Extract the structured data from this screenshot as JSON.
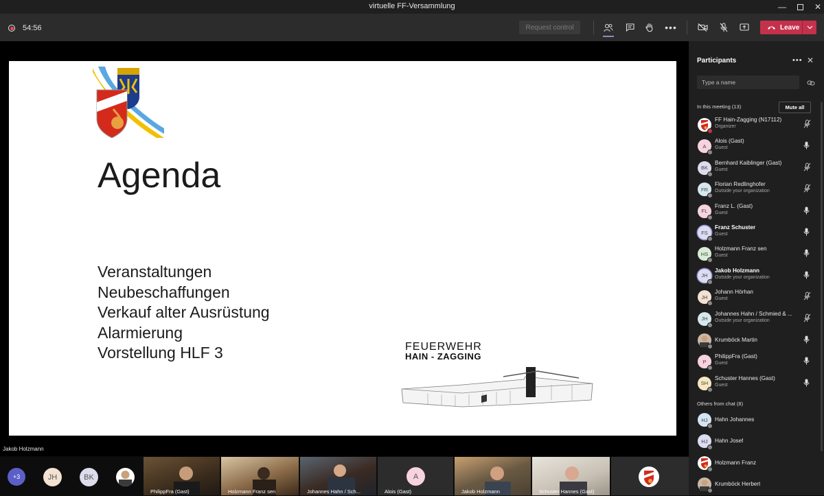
{
  "window": {
    "title": "virtuelle FF-Versammlung"
  },
  "toolbar": {
    "timer": "54:56",
    "request_control_label": "Request control",
    "leave_label": "Leave",
    "colors": {
      "leave": "#c4314b",
      "accent": "#8b8cc7"
    }
  },
  "slide": {
    "heading": "Agenda",
    "items": [
      "Veranstaltungen",
      "Neubeschaffungen",
      "Verkauf alter Ausrüstung",
      "Alarmierung",
      "Vorstellung HLF 3"
    ],
    "logo_line1": "FEUERWEHR",
    "logo_line2": "HAIN - ZAGGING"
  },
  "stage": {
    "speaker_name": "Jakob Holzmann"
  },
  "strip": {
    "overflow_count": "+3",
    "avatars": [
      "JH",
      "BK"
    ],
    "tiles": [
      {
        "name": "PhilippFra (Gast)"
      },
      {
        "name": "Holzmann Franz sen"
      },
      {
        "name": "Johannes Hahn / Sch..."
      },
      {
        "name": "Alois (Gast)",
        "initial": "A"
      },
      {
        "name": "Jakob Holzmann"
      },
      {
        "name": "Schuster Hannes (Gast)"
      }
    ]
  },
  "participants": {
    "title": "Participants",
    "search_placeholder": "Type a name",
    "in_meeting_label": "In this meeting (13)",
    "mute_all_label": "Mute all",
    "others_label": "Others from chat (8)",
    "in_meeting": [
      {
        "initials": "",
        "name": "FF Hain-Zagging (N17112)",
        "role": "Organizer",
        "mic": "muted",
        "bold": false,
        "bg": "#ffffff"
      },
      {
        "initials": "A",
        "name": "Alois (Gast)",
        "role": "Guest",
        "mic": "on",
        "bold": false,
        "bg": "#f6d3de"
      },
      {
        "initials": "BK",
        "name": "Bernhard Kaiblinger (Gast)",
        "role": "Guest",
        "mic": "muted",
        "bold": false,
        "bg": "#dcdcec"
      },
      {
        "initials": "FR",
        "name": "Florian Redlinghofer",
        "role": "Outside your organization",
        "mic": "muted",
        "bold": false,
        "bg": "#d4e8ee"
      },
      {
        "initials": "FL",
        "name": "Franz L. (Gast)",
        "role": "Guest",
        "mic": "on",
        "bold": false,
        "bg": "#f6d3de"
      },
      {
        "initials": "FS",
        "name": "Franz Schuster",
        "role": "Guest",
        "mic": "on",
        "bold": true,
        "bg": "#dcdcf2"
      },
      {
        "initials": "HS",
        "name": "Holzmann Franz sen",
        "role": "Guest",
        "mic": "on",
        "bold": false,
        "bg": "#d8ecd6"
      },
      {
        "initials": "JH",
        "name": "Jakob Holzmann",
        "role": "Outside your organization",
        "mic": "on",
        "bold": true,
        "bg": "#dcdcf2"
      },
      {
        "initials": "JH",
        "name": "Johann Hörhan",
        "role": "Guest",
        "mic": "muted",
        "bold": false,
        "bg": "#f3e2d2"
      },
      {
        "initials": "JH",
        "name": "Johannes Hahn / Schmied & ...",
        "role": "Outside your organization",
        "mic": "muted",
        "bold": false,
        "bg": "#d4e8ee"
      },
      {
        "initials": "",
        "name": "Krumböck Martin",
        "role": "",
        "mic": "on",
        "bold": false,
        "bg": "#c8b8a8"
      },
      {
        "initials": "P",
        "name": "PhilippFra (Gast)",
        "role": "Guest",
        "mic": "on",
        "bold": false,
        "bg": "#f6d3de"
      },
      {
        "initials": "SH",
        "name": "Schuster Hannes (Gast)",
        "role": "Guest",
        "mic": "on",
        "bold": false,
        "bg": "#f5e8c0"
      }
    ],
    "others": [
      {
        "initials": "HJ",
        "name": "Hahn Johannes",
        "bg": "#d4e4f2"
      },
      {
        "initials": "HJ",
        "name": "Hahn Josef",
        "bg": "#dcdcf2"
      },
      {
        "initials": "",
        "name": "Holzmann Franz",
        "bg": "#ffffff"
      },
      {
        "initials": "",
        "name": "Krumböck Herbert",
        "bg": "#c8b8a8"
      }
    ]
  }
}
